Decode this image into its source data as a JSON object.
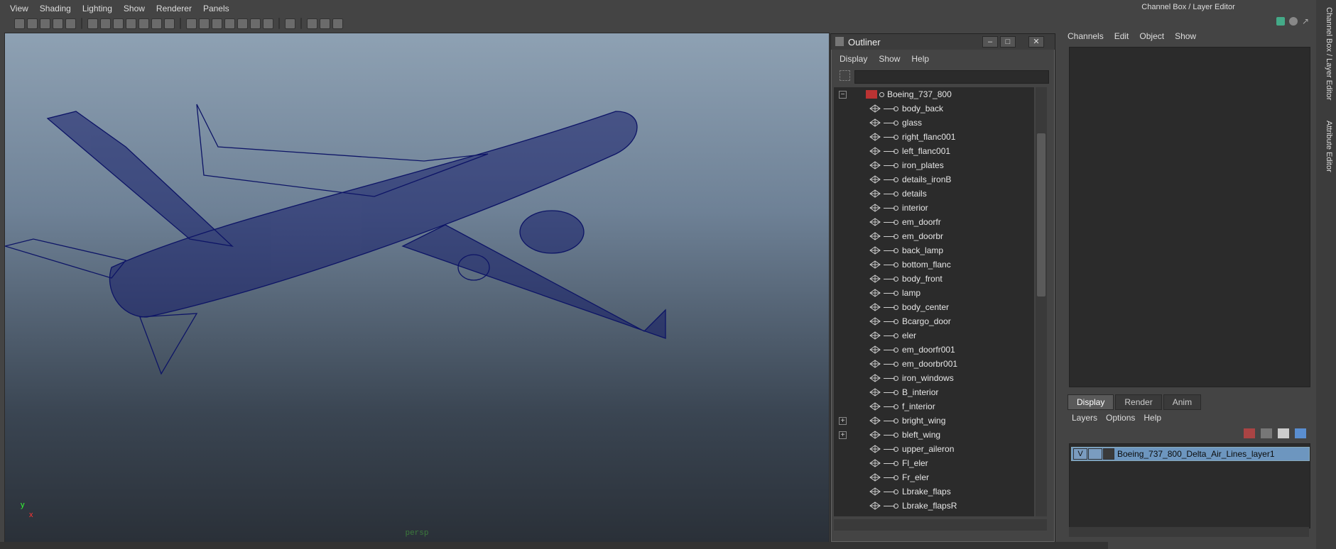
{
  "viewport": {
    "menu": [
      "View",
      "Shading",
      "Lighting",
      "Show",
      "Renderer",
      "Panels"
    ],
    "camera_label": "persp",
    "axis": {
      "x": "x",
      "y": "y"
    }
  },
  "outliner": {
    "title": "Outliner",
    "menu": [
      "Display",
      "Show",
      "Help"
    ],
    "root": "Boeing_737_800",
    "items": [
      "body_back",
      "glass",
      "right_flanc001",
      "left_flanc001",
      "iron_plates",
      "details_ironB",
      "details",
      "interior",
      "em_doorfr",
      "em_doorbr",
      "back_lamp",
      "bottom_flanc",
      "body_front",
      "lamp",
      "body_center",
      "Bcargo_door",
      "eler",
      "em_doorfr001",
      "em_doorbr001",
      "iron_windows",
      "B_interior",
      "f_interior",
      "bright_wing",
      "bleft_wing",
      "upper_aileron",
      "Fl_eler",
      "Fr_eler",
      "Lbrake_flaps",
      "Lbrake_flapsR"
    ],
    "expandable": [
      "bright_wing",
      "bleft_wing"
    ]
  },
  "channel_box": {
    "title": "Channel Box / Layer Editor",
    "menu": [
      "Channels",
      "Edit",
      "Object",
      "Show"
    ]
  },
  "layer_editor": {
    "tabs": [
      "Display",
      "Render",
      "Anim"
    ],
    "menu": [
      "Layers",
      "Options",
      "Help"
    ],
    "layer": {
      "visible": "V",
      "name": "Boeing_737_800_Delta_Air_Lines_layer1"
    }
  },
  "side_tabs": [
    "Channel Box / Layer Editor",
    "Attribute Editor"
  ],
  "colors": {
    "wireframe": "#0d1466",
    "layer_selected": "#6d96bf"
  }
}
